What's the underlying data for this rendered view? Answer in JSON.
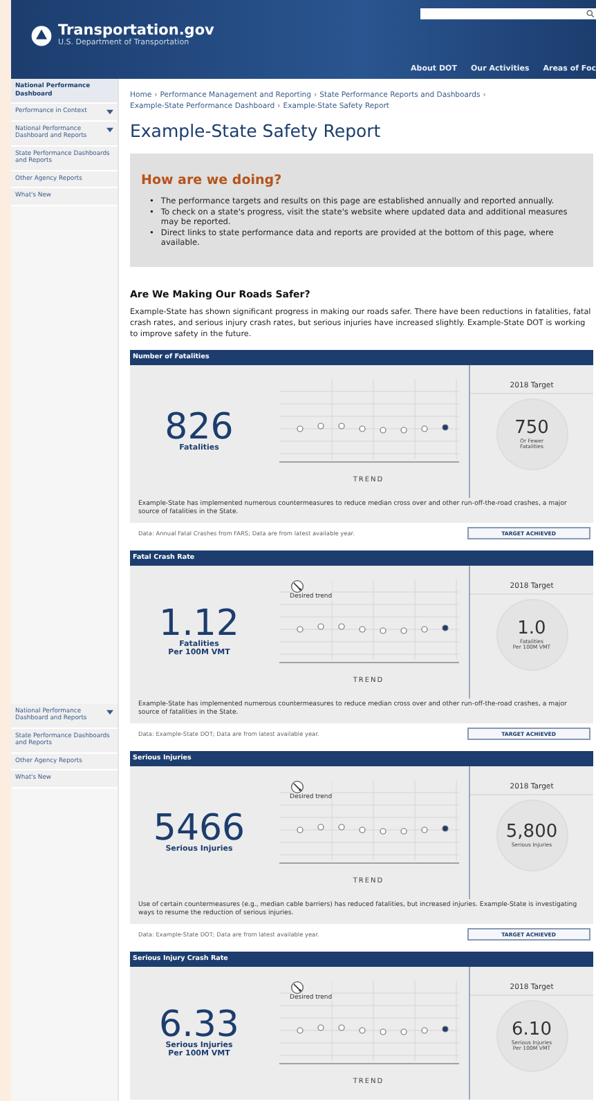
{
  "header": {
    "site_name": "Transportation.gov",
    "subtitle": "U.S. Department of Transportation",
    "nav": [
      "About DOT",
      "Our Activities",
      "Areas of Foc"
    ]
  },
  "sidebar": {
    "items": [
      {
        "label": "National Performance Dashboard",
        "selected": true,
        "submenu": false
      },
      {
        "label": "Performance in Context",
        "selected": false,
        "submenu": true
      },
      {
        "label": "National Performance Dashboard and Reports",
        "selected": false,
        "submenu": true
      },
      {
        "label": "State Performance Dashboards and Reports",
        "selected": false,
        "submenu": false
      },
      {
        "label": "Other Agency Reports",
        "selected": false,
        "submenu": false
      },
      {
        "label": "What's New",
        "selected": false,
        "submenu": false
      }
    ],
    "lower_items": [
      {
        "label": "National Performance Dashboard and Reports",
        "selected": false,
        "submenu": true
      },
      {
        "label": "State Performance Dashboards and Reports",
        "selected": false,
        "submenu": false
      },
      {
        "label": "Other Agency Reports",
        "selected": false,
        "submenu": false
      },
      {
        "label": "What's New",
        "selected": false,
        "submenu": false
      }
    ]
  },
  "breadcrumb": {
    "separator": "›",
    "items": [
      "Home",
      "Performance Management and Reporting",
      "State Performance Reports and Dashboards",
      "Example-State Performance Dashboard",
      "Example-State Safety Report"
    ]
  },
  "title": "Example-State Safety Report",
  "summary_box": {
    "heading": "How are we doing?",
    "bullet_marker": "•",
    "bullets": [
      "The performance targets and results on this page are established annually and reported annually.",
      "To check on a state's progress, visit the state's website where updated data and additional measures may be reported.",
      "Direct links to state performance data and reports are provided at the bottom of this page, where available."
    ]
  },
  "section_heading": "Are We Making Our Roads Safer?",
  "intro": "Example-State has shown significant progress in making our roads safer. There have been reductions in fatalities, fatal crash rates, and serious injury crash rates, but serious injuries have increased slightly. Example-State DOT is working to improve safety in the future.",
  "cards": [
    {
      "title": "Number of Fatalities",
      "value": "826",
      "unit_lines": [
        "Fatalities"
      ],
      "trend_label": "TREND",
      "target_label": "2018 Target",
      "target_value": "750",
      "target_lines": [
        "Or Fewer",
        "Fatalities"
      ],
      "description": "Example-State has implemented numerous countermeasures to reduce median cross over and other run-off-the-road crashes, a major source of fatalities in the State.",
      "data_source": "Data: Annual Fatal Crashes from FARS; Data are from latest available year.",
      "status": "TARGET ACHIEVED"
    },
    {
      "title": "Fatal Crash Rate",
      "value": "1.12",
      "unit_lines": [
        "Fatalities",
        "Per 100M VMT"
      ],
      "desired_trend": "Desired trend",
      "trend_label": "TREND",
      "target_label": "2018 Target",
      "target_value": "1.0",
      "target_lines": [
        "Fatalities",
        "Per 100M VMT"
      ],
      "description": "Example-State has implemented numerous countermeasures to reduce median cross over and other run-off-the-road crashes, a major source of fatalities in the State.",
      "data_source": "Data: Example-State DOT; Data are from latest available year.",
      "status": "TARGET ACHIEVED"
    },
    {
      "title": "Serious Injuries",
      "value": "5466",
      "unit_lines": [
        "Serious Injuries"
      ],
      "desired_trend": "Desired trend",
      "trend_label": "TREND",
      "target_label": "2018 Target",
      "target_value": "5,800",
      "target_lines": [
        "Serious Injuries"
      ],
      "description": "Use of certain countermeasures (e.g., median cable barriers) has reduced fatalities, but increased injuries. Example-State is investigating ways to resume the reduction of serious injuries.",
      "data_source": "Data: Example-State DOT; Data are from latest available year.",
      "status": "TARGET ACHIEVED"
    },
    {
      "title": "Serious Injury Crash Rate",
      "value": "6.33",
      "unit_lines": [
        "Serious Injuries",
        "Per 100M VMT"
      ],
      "desired_trend": "Desired trend",
      "trend_label": "TREND",
      "target_label": "2018 Target",
      "target_value": "6.10",
      "target_lines": [
        "Serious Injuries",
        "Per 100M VMT"
      ]
    }
  ]
}
